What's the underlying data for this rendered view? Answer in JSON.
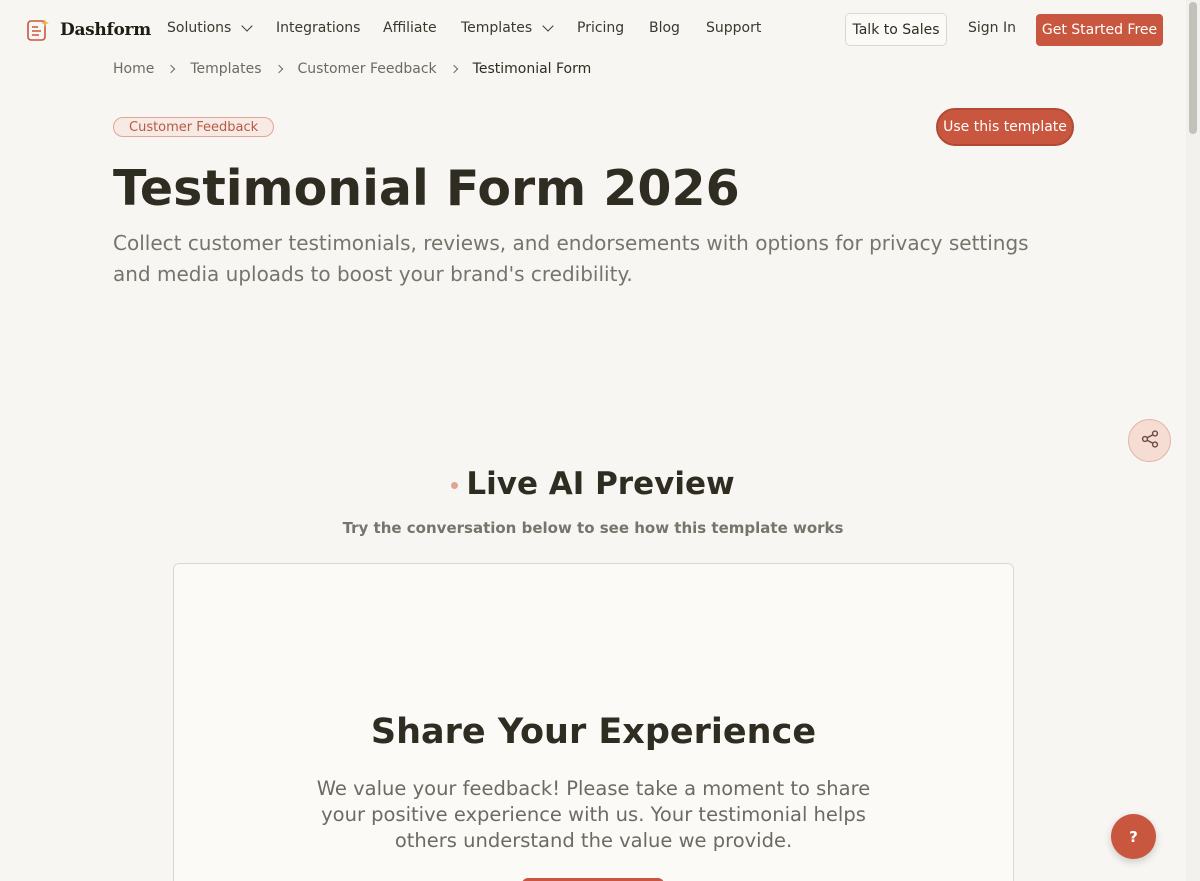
{
  "brand": {
    "name": "Dashform",
    "accent": "#c9573f"
  },
  "nav": {
    "links": [
      {
        "label": "Solutions",
        "dropdown": true
      },
      {
        "label": "Integrations",
        "dropdown": false
      },
      {
        "label": "Affiliate",
        "dropdown": false
      },
      {
        "label": "Templates",
        "dropdown": true
      },
      {
        "label": "Pricing",
        "dropdown": false
      },
      {
        "label": "Blog",
        "dropdown": false
      },
      {
        "label": "Support",
        "dropdown": false
      }
    ],
    "talk_to_sales": "Talk to Sales",
    "sign_in": "Sign In",
    "get_started": "Get Started Free"
  },
  "breadcrumb": [
    "Home",
    "Templates",
    "Customer Feedback",
    "Testimonial Form"
  ],
  "hero": {
    "category": "Customer Feedback",
    "use_template": "Use this template",
    "title": "Testimonial Form 2026",
    "subtitle": "Collect customer testimonials, reviews, and endorsements with options for privacy settings and media uploads to boost your brand's credibility."
  },
  "preview": {
    "title": "Live AI Preview",
    "subtitle": "Try the conversation below to see how this template works",
    "form_title": "Share Your Experience",
    "form_description": "We value your feedback! Please take a moment to share your positive experience with us. Your testimonial helps others understand the value we provide."
  },
  "icons": {
    "share": "share-icon",
    "help": "help-icon",
    "logo": "form-sparkle-icon"
  },
  "help_label": "?"
}
